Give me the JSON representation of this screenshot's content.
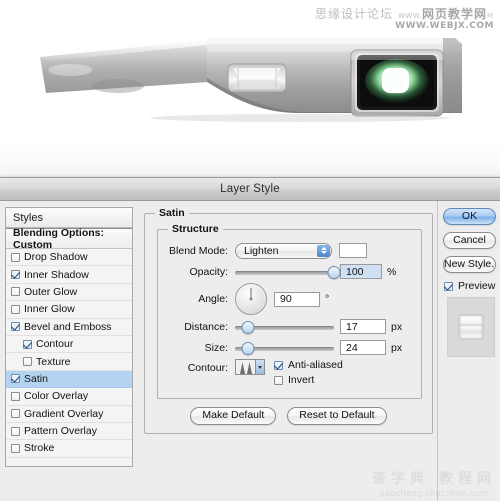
{
  "photo": {
    "alt_description": "silver metallic handheld device with green illuminated lens",
    "watermark_top_line1_cn": "思缘设计论坛",
    "watermark_top_line1_www": "www.",
    "watermark_top_line1_big": "网页教学网",
    "watermark_top_line1_suffix": "M",
    "watermark_top_line2": "WWW.WEBJX.COM"
  },
  "dialog": {
    "title": "Layer Style",
    "styles_panel": {
      "header": "Styles",
      "blending_options": "Blending Options: Custom",
      "items": [
        {
          "label": "Drop Shadow",
          "checked": false,
          "indent": false,
          "selected": false
        },
        {
          "label": "Inner Shadow",
          "checked": true,
          "indent": false,
          "selected": false
        },
        {
          "label": "Outer Glow",
          "checked": false,
          "indent": false,
          "selected": false
        },
        {
          "label": "Inner Glow",
          "checked": false,
          "indent": false,
          "selected": false
        },
        {
          "label": "Bevel and Emboss",
          "checked": true,
          "indent": false,
          "selected": false
        },
        {
          "label": "Contour",
          "checked": true,
          "indent": true,
          "selected": false
        },
        {
          "label": "Texture",
          "checked": false,
          "indent": true,
          "selected": false
        },
        {
          "label": "Satin",
          "checked": true,
          "indent": false,
          "selected": true
        },
        {
          "label": "Color Overlay",
          "checked": false,
          "indent": false,
          "selected": false
        },
        {
          "label": "Gradient Overlay",
          "checked": false,
          "indent": false,
          "selected": false
        },
        {
          "label": "Pattern Overlay",
          "checked": false,
          "indent": false,
          "selected": false
        },
        {
          "label": "Stroke",
          "checked": false,
          "indent": false,
          "selected": false
        }
      ]
    },
    "main_panel": {
      "group_title": "Satin",
      "structure_title": "Structure",
      "blend_mode": {
        "label": "Blend Mode:",
        "value": "Lighten",
        "swatch_color": "#ffffff"
      },
      "opacity": {
        "label": "Opacity:",
        "value": "100",
        "unit": "%",
        "percent": 100
      },
      "angle": {
        "label": "Angle:",
        "value": "90",
        "unit": "°",
        "degrees": 90
      },
      "distance": {
        "label": "Distance:",
        "value": "17",
        "unit": "px",
        "percent": 13
      },
      "size": {
        "label": "Size:",
        "value": "24",
        "unit": "px",
        "percent": 13
      },
      "contour": {
        "label": "Contour:"
      },
      "anti_aliased": {
        "label": "Anti-aliased",
        "checked": true
      },
      "invert": {
        "label": "Invert",
        "checked": false
      },
      "make_default": "Make Default",
      "reset_default": "Reset to Default"
    },
    "right_panel": {
      "ok": "OK",
      "cancel": "Cancel",
      "new_style": "New Style...",
      "preview": {
        "label": "Preview",
        "checked": true
      }
    }
  },
  "watermark_bottom": {
    "line1": "查字典 教程网",
    "line2": "jiaocheng.chazidian.com"
  },
  "colors": {
    "selection_blue": "#b4d3f0",
    "primary_button_blue": "#7fb0e8",
    "dialog_bg": "#ededed"
  }
}
